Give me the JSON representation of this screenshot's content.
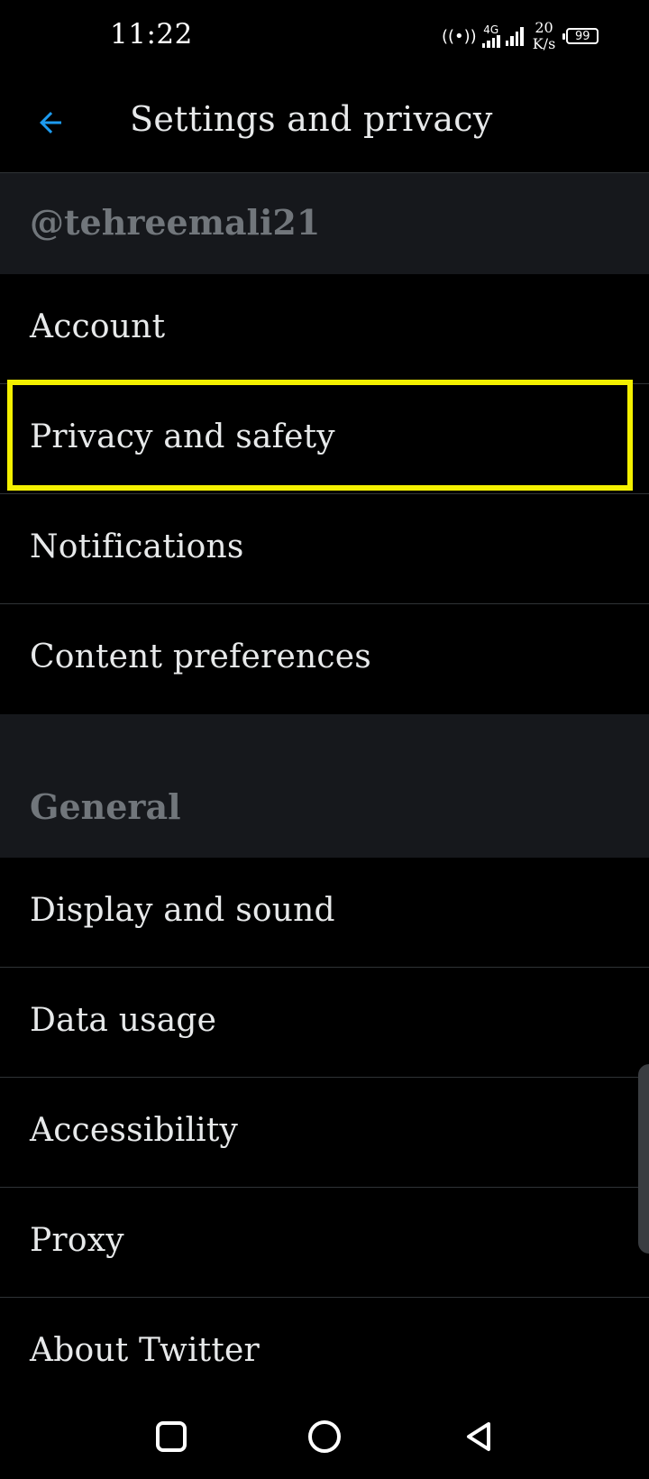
{
  "status_bar": {
    "time": "11:22",
    "network_type": "4G",
    "speed_value": "20",
    "speed_unit": "K/s",
    "battery": "99"
  },
  "app_bar": {
    "title": "Settings and privacy",
    "back_icon": "arrow-left-icon",
    "accent_color": "#1d9bf0"
  },
  "sections": {
    "account_header": "@tehreemali21",
    "general_header": "General"
  },
  "account_items": [
    {
      "label": "Account"
    },
    {
      "label": "Privacy and safety"
    },
    {
      "label": "Notifications"
    },
    {
      "label": "Content preferences"
    }
  ],
  "general_items": [
    {
      "label": "Display and sound"
    },
    {
      "label": "Data usage"
    },
    {
      "label": "Accessibility"
    },
    {
      "label": "Proxy"
    },
    {
      "label": "About Twitter"
    }
  ],
  "highlight": {
    "target": "Privacy and safety",
    "color": "#f4f000"
  },
  "nav_bar": {
    "recents_icon": "square-icon",
    "home_icon": "circle-icon",
    "back_icon": "triangle-back-icon"
  }
}
